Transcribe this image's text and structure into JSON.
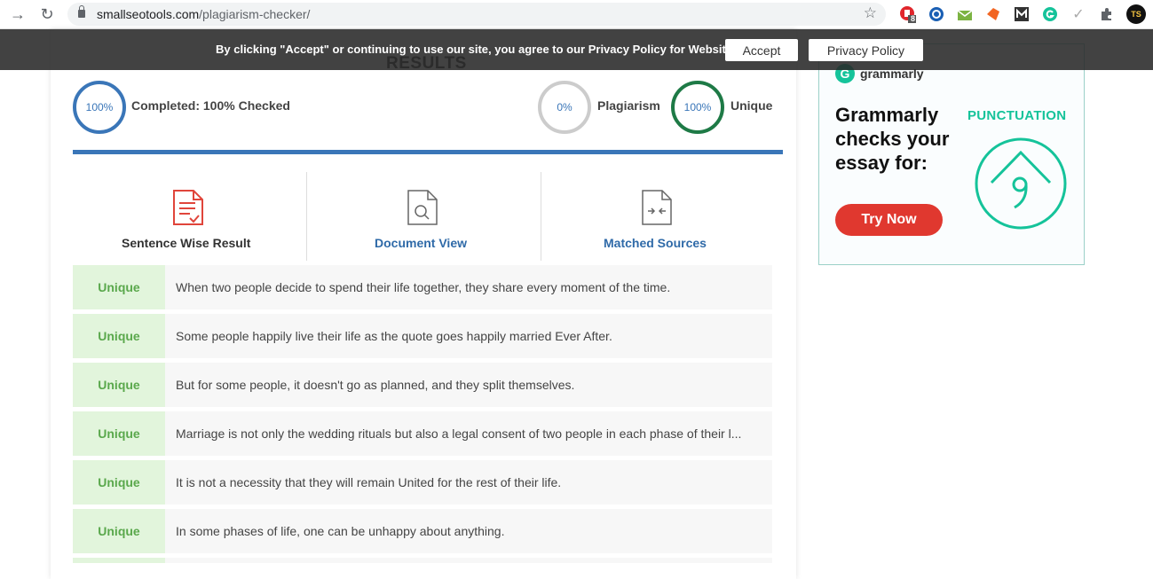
{
  "browser": {
    "url_host": "smallseotools.com",
    "url_path": "/plagiarism-checker/",
    "extension_badge": "8",
    "avatar_initials": "TS"
  },
  "cookie_bar": {
    "message": "By clicking \"Accept\" or continuing to use our site, you agree to our Privacy Policy for Website",
    "accept_label": "Accept",
    "privacy_label": "Privacy Policy"
  },
  "results": {
    "title": "RESULTS",
    "completed_percent": "100%",
    "completed_label": "Completed: 100% Checked",
    "plagiarism_percent": "0%",
    "plagiarism_label": "Plagiarism",
    "unique_percent": "100%",
    "unique_label": "Unique",
    "progress_fraction": 1.0
  },
  "tabs": [
    {
      "label": "Sentence Wise Result",
      "icon": "document-check-icon"
    },
    {
      "label": "Document View",
      "icon": "document-search-icon"
    },
    {
      "label": "Matched Sources",
      "icon": "document-compare-icon"
    }
  ],
  "sentences": [
    {
      "status": "Unique",
      "text": "When two people decide to spend their life together, they share every moment of the time."
    },
    {
      "status": "Unique",
      "text": "Some people happily live their life as the quote goes happily married Ever After."
    },
    {
      "status": "Unique",
      "text": "But for some people, it doesn't go as planned, and they split themselves."
    },
    {
      "status": "Unique",
      "text": "Marriage is not only the wedding rituals but also a legal consent of two people in each phase of their l..."
    },
    {
      "status": "Unique",
      "text": "It is not a necessity that they will remain United for the rest of their life."
    },
    {
      "status": "Unique",
      "text": "In some phases of life, one can be unhappy about anything."
    }
  ],
  "ad": {
    "brand": "grammarly",
    "headline": "Grammarly checks your essay for:",
    "tagline": "PUNCTUATION",
    "cta": "Try Now"
  },
  "colors": {
    "accent_blue": "#3a76b8",
    "unique_green": "#5aa84c",
    "grammarly_green": "#15c39a",
    "cta_red": "#e0382f"
  }
}
